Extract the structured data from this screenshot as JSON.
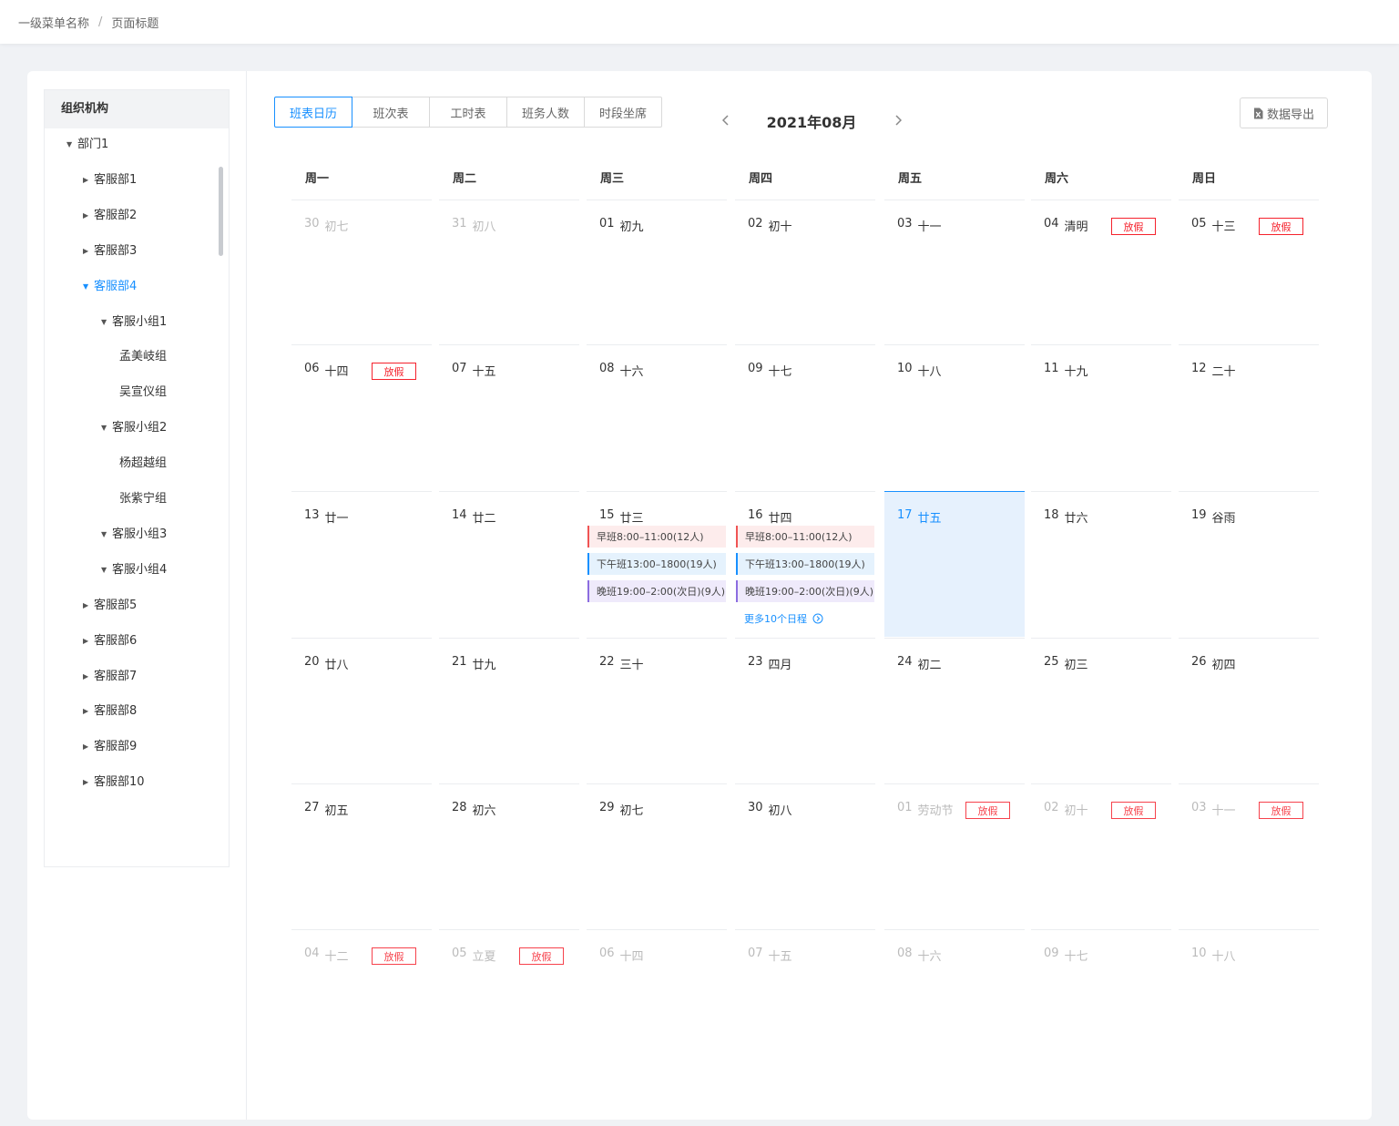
{
  "breadcrumb": {
    "level1": "一级菜单名称",
    "separator": "/",
    "current": "页面标题"
  },
  "org": {
    "title": "组织机构",
    "items": [
      {
        "label": "部门1",
        "level": 0,
        "expanded": true
      },
      {
        "label": "客服部1",
        "level": 1,
        "expanded": false
      },
      {
        "label": "客服部2",
        "level": 1,
        "expanded": false
      },
      {
        "label": "客服部3",
        "level": 1,
        "expanded": false
      },
      {
        "label": "客服部4",
        "level": 1,
        "expanded": true,
        "active": true
      },
      {
        "label": "客服小组1",
        "level": 2,
        "expanded": true
      },
      {
        "label": "孟美岐组",
        "level": 3,
        "leaf": true
      },
      {
        "label": "吴宣仪组",
        "level": 3,
        "leaf": true
      },
      {
        "label": "客服小组2",
        "level": 2,
        "expanded": true
      },
      {
        "label": "杨超越组",
        "level": 3,
        "leaf": true
      },
      {
        "label": "张紫宁组",
        "level": 3,
        "leaf": true
      },
      {
        "label": "客服小组3",
        "level": 2,
        "expanded": true
      },
      {
        "label": "客服小组4",
        "level": 2,
        "expanded": true
      },
      {
        "label": "客服部5",
        "level": 1,
        "expanded": false
      },
      {
        "label": "客服部6",
        "level": 1,
        "expanded": false
      },
      {
        "label": "客服部7",
        "level": 1,
        "expanded": false
      },
      {
        "label": "客服部8",
        "level": 1,
        "expanded": false
      },
      {
        "label": "客服部9",
        "level": 1,
        "expanded": false
      },
      {
        "label": "客服部10",
        "level": 1,
        "expanded": false
      }
    ]
  },
  "tabs": [
    {
      "label": "班表日历",
      "active": true
    },
    {
      "label": "班次表"
    },
    {
      "label": "工时表"
    },
    {
      "label": "班务人数"
    },
    {
      "label": "时段坐席"
    }
  ],
  "calendar": {
    "month_title": "2021年08月",
    "prev_icon": "chevron-left-icon",
    "next_icon": "chevron-right-icon",
    "export_label": "数据导出",
    "export_icon": "excel-file-icon",
    "weekdays": [
      "周一",
      "周二",
      "周三",
      "周四",
      "周五",
      "周六",
      "周日"
    ],
    "holiday_label": "放假",
    "weeks": [
      [
        {
          "day": "30",
          "lunar": "初七",
          "other": true
        },
        {
          "day": "31",
          "lunar": "初八",
          "other": true
        },
        {
          "day": "01",
          "lunar": "初九"
        },
        {
          "day": "02",
          "lunar": "初十"
        },
        {
          "day": "03",
          "lunar": "十一"
        },
        {
          "day": "04",
          "lunar": "清明",
          "holiday": true
        },
        {
          "day": "05",
          "lunar": "十三",
          "holiday": true
        }
      ],
      [
        {
          "day": "06",
          "lunar": "十四",
          "holiday": true
        },
        {
          "day": "07",
          "lunar": "十五"
        },
        {
          "day": "08",
          "lunar": "十六"
        },
        {
          "day": "09",
          "lunar": "十七"
        },
        {
          "day": "10",
          "lunar": "十八"
        },
        {
          "day": "11",
          "lunar": "十九"
        },
        {
          "day": "12",
          "lunar": "二十"
        }
      ],
      [
        {
          "day": "13",
          "lunar": "廿一"
        },
        {
          "day": "14",
          "lunar": "廿二"
        },
        {
          "day": "15",
          "lunar": "廿三",
          "shifts": [
            {
              "type": "early",
              "text": "早班8:00–11:00(12人)"
            },
            {
              "type": "after",
              "text": "下午班13:00–1800(19人)"
            },
            {
              "type": "night",
              "text": "晚班19:00–2:00(次日)(9人)"
            }
          ]
        },
        {
          "day": "16",
          "lunar": "廿四",
          "shifts": [
            {
              "type": "early",
              "text": "早班8:00–11:00(12人)"
            },
            {
              "type": "after",
              "text": "下午班13:00–1800(19人)"
            },
            {
              "type": "night",
              "text": "晚班19:00–2:00(次日)(9人)"
            }
          ],
          "more": "更多10个日程"
        },
        {
          "day": "17",
          "lunar": "廿五",
          "today": true
        },
        {
          "day": "18",
          "lunar": "廿六"
        },
        {
          "day": "19",
          "lunar": "谷雨"
        }
      ],
      [
        {
          "day": "20",
          "lunar": "廿八"
        },
        {
          "day": "21",
          "lunar": "廿九"
        },
        {
          "day": "22",
          "lunar": "三十"
        },
        {
          "day": "23",
          "lunar": "四月"
        },
        {
          "day": "24",
          "lunar": "初二"
        },
        {
          "day": "25",
          "lunar": "初三"
        },
        {
          "day": "26",
          "lunar": "初四"
        }
      ],
      [
        {
          "day": "27",
          "lunar": "初五"
        },
        {
          "day": "28",
          "lunar": "初六"
        },
        {
          "day": "29",
          "lunar": "初七"
        },
        {
          "day": "30",
          "lunar": "初八"
        },
        {
          "day": "01",
          "lunar": "劳动节",
          "other": true,
          "holiday": true
        },
        {
          "day": "02",
          "lunar": "初十",
          "other": true,
          "holiday": true
        },
        {
          "day": "03",
          "lunar": "十一",
          "other": true,
          "holiday": true
        }
      ],
      [
        {
          "day": "04",
          "lunar": "十二",
          "other": true,
          "holiday": true
        },
        {
          "day": "05",
          "lunar": "立夏",
          "other": true,
          "holiday": true
        },
        {
          "day": "06",
          "lunar": "十四",
          "other": true
        },
        {
          "day": "07",
          "lunar": "十五",
          "other": true
        },
        {
          "day": "08",
          "lunar": "十六",
          "other": true
        },
        {
          "day": "09",
          "lunar": "十七",
          "other": true
        },
        {
          "day": "10",
          "lunar": "十八",
          "other": true
        }
      ]
    ]
  },
  "colors": {
    "primary": "#1890ff",
    "holiday": "#f5222d",
    "early_shift": "#f05454",
    "afternoon_shift": "#1890ff",
    "night_shift": "#8c6de0",
    "today_bg": "#e6f1fd"
  }
}
